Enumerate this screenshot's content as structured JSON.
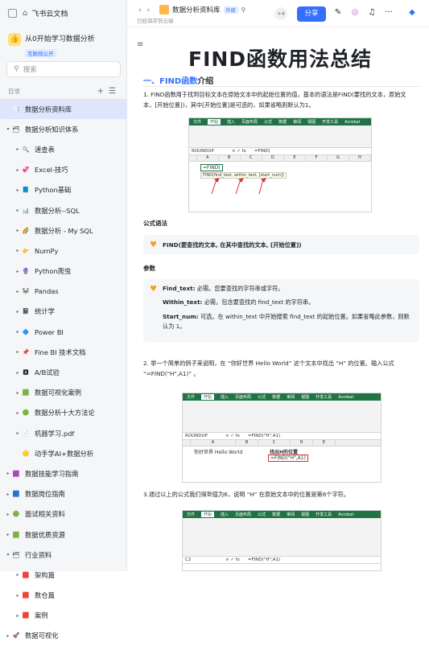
{
  "brand": {
    "name": "飞书云文档"
  },
  "workspace": {
    "name": "从0开始学习数据分析",
    "tag": "互联网公开",
    "icon": "👍"
  },
  "search": {
    "placeholder": "搜索"
  },
  "toc": {
    "label": "目录"
  },
  "tree": [
    {
      "label": "数据分析资料库",
      "icon": "📑",
      "level": 0,
      "toggle": "",
      "active": true
    },
    {
      "label": "数据分析知识体系",
      "icon": "🗂",
      "level": 0,
      "toggle": "▾"
    },
    {
      "label": "速查表",
      "icon": "🔍",
      "level": 1,
      "toggle": "▸"
    },
    {
      "label": "Excel-技巧",
      "icon": "💞",
      "level": 1,
      "toggle": "▸"
    },
    {
      "label": "Python基础",
      "icon": "📘",
      "level": 1,
      "toggle": "▸"
    },
    {
      "label": "数据分析--SQL",
      "icon": "📊",
      "level": 1,
      "toggle": "▸"
    },
    {
      "label": "数据分析 - My SQL",
      "icon": "🌈",
      "level": 1,
      "toggle": "▸"
    },
    {
      "label": "NumPy",
      "icon": "👉",
      "level": 1,
      "toggle": "▸"
    },
    {
      "label": "Python爬虫",
      "icon": "🔮",
      "level": 1,
      "toggle": "▸"
    },
    {
      "label": "Pandas",
      "icon": "🐼",
      "level": 1,
      "toggle": "▸"
    },
    {
      "label": "统计学",
      "icon": "📓",
      "level": 1,
      "toggle": "▸"
    },
    {
      "label": "Power BI",
      "icon": "🔷",
      "level": 1,
      "toggle": "▸"
    },
    {
      "label": "Fine BI 技术文档",
      "icon": "📌",
      "level": 1,
      "toggle": "▸"
    },
    {
      "label": "A/B试验",
      "icon": "🅰",
      "level": 1,
      "toggle": "▸"
    },
    {
      "label": "数据可视化案例",
      "icon": "🟩",
      "level": 1,
      "toggle": "▸"
    },
    {
      "label": "数据分析十大方法论",
      "icon": "🟢",
      "level": 1,
      "toggle": "▸"
    },
    {
      "label": "机器学习.pdf",
      "icon": "📄",
      "level": 1,
      "toggle": "▸"
    },
    {
      "label": "动手学AI+数据分析",
      "icon": "🟡",
      "level": 1,
      "toggle": ""
    },
    {
      "label": "数据技能学习指南",
      "icon": "🟪",
      "level": 0,
      "toggle": "▸"
    },
    {
      "label": "数据岗位指南",
      "icon": "🟦",
      "level": 0,
      "toggle": "▸"
    },
    {
      "label": "面试相关资料",
      "icon": "🟢",
      "level": 0,
      "toggle": "▸"
    },
    {
      "label": "数据优质资源",
      "icon": "🟩",
      "level": 0,
      "toggle": "▸"
    },
    {
      "label": "行业资料",
      "icon": "🗂",
      "level": 0,
      "toggle": "▾"
    },
    {
      "label": "架构篇",
      "icon": "🟥",
      "level": 1,
      "toggle": "▸"
    },
    {
      "label": "数仓篇",
      "icon": "🟥",
      "level": 1,
      "toggle": "▸"
    },
    {
      "label": "案例",
      "icon": "🟥",
      "level": 1,
      "toggle": "▸"
    },
    {
      "label": "数据可视化",
      "icon": "🚀",
      "level": 0,
      "toggle": "▸"
    }
  ],
  "topbar": {
    "nav": "‹  ›",
    "title": "数据分析资料库",
    "ext_tag": "外部",
    "saved": "已经保存到云端",
    "collab": "+4",
    "share": "分享"
  },
  "doc": {
    "title": "FIND函数用法总结",
    "section1_num": "一、",
    "section1_kw": "FIND函数",
    "section1_rest": "介绍",
    "p1": "1. FIND函数用于找到目标文本在原始文本中的起始位置的值，基本的语法是FIND(要找的文本，原始文本，[开始位置])，其中[开始位置]是可选的，如果省略则默认为1。",
    "formula_head": "公式语法",
    "formula": "FIND(要查找的文本, 在其中查找的文本, [开始位置])",
    "params_head": "参数",
    "param1_name": "Find_text:",
    "param1_desc": "必需。您要查找的字符串或字符。",
    "param2_name": "Within_text:",
    "param2_desc": "必需。包含要查找的 find_text 的字符串。",
    "param3_name": "Start_num:",
    "param3_desc": "可选。在 within_text 中开始搜索 find_text 的起始位置。如果省略此参数，则默认为 1。",
    "p2": "2. 举一个简单的例子来说明，在 “你好世界 Hello World” 这个文本中找出 “H” 的位置。输入公式 “=FIND(\"H\",A1)” 。",
    "p3": "3.通过以上的公式我们得到值为6，说明 “H” 在原始文本中的位置是第6个字符。"
  },
  "excel1": {
    "tabs": [
      "文件",
      "开始",
      "插入",
      "页面布局",
      "公式",
      "数据",
      "审阅",
      "视图",
      "开发工具",
      "Acrobat"
    ],
    "namebox": "ROUNDUP",
    "formula": "=FIND(",
    "cell": "=FIND(",
    "tip": "FIND(find_text, within_text, [start_num])"
  },
  "excel2": {
    "tabs": [
      "文件",
      "开始",
      "插入",
      "页面布局",
      "公式",
      "数据",
      "审阅",
      "视图",
      "开发工具",
      "Acrobat"
    ],
    "namebox": "ROUNDUP",
    "formula": "=FIND(\"H\",A1)",
    "a1": "你好世界 Hello World",
    "c1": "找出H的位置",
    "c2": "=FIND(\"H\",A1)"
  },
  "excel3": {
    "tabs": [
      "文件",
      "开始",
      "插入",
      "页面布局",
      "公式",
      "数据",
      "审阅",
      "视图",
      "开发工具",
      "Acrobat"
    ],
    "namebox": "C2",
    "formula": "=FIND(\"H\",A1)"
  }
}
